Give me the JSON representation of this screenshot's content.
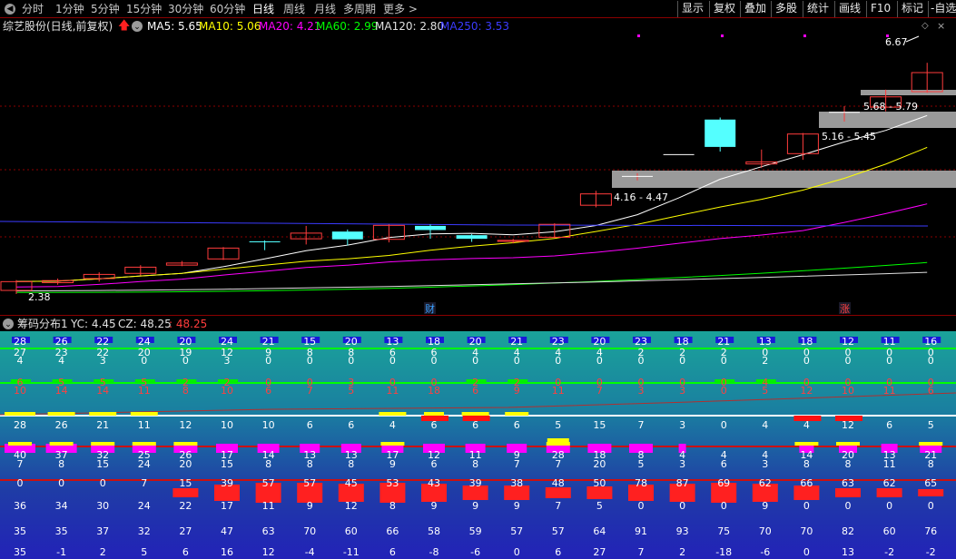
{
  "toolbar": {
    "periods": [
      "分时",
      "1分钟",
      "5分钟",
      "15分钟",
      "30分钟",
      "60分钟",
      "日线",
      "周线",
      "月线",
      "多周期",
      "更多 >"
    ],
    "active_period": "日线",
    "tools": [
      "显示",
      "复权",
      "叠加",
      "多股",
      "统计",
      "画线",
      "F10",
      "标记",
      "-自选"
    ]
  },
  "kline": {
    "title": "综艺股份(日线,前复权)",
    "up_arrow_icon": "red-up-arrow-icon",
    "ma": [
      {
        "label": "MA5: 5.65",
        "color": "#ffffff"
      },
      {
        "label": "MA10: 5.06",
        "color": "#ffff00"
      },
      {
        "label": "MA20: 4.21",
        "color": "#ff00ff"
      },
      {
        "label": "MA60: 2.99",
        "color": "#00ff00"
      },
      {
        "label": "MA120: 2.80",
        "color": "#e0e0e0"
      },
      {
        "label": "MA250: 3.53",
        "color": "#3b3bff"
      }
    ],
    "price_tags": [
      "6.67",
      "5.68 - 5.79",
      "5.16 - 5.45",
      "4.16 - 4.47",
      "2.38"
    ],
    "event_tags": [
      {
        "text": "财",
        "color": "#3aa0ff"
      },
      {
        "text": "涨",
        "color": "#ff4040"
      }
    ],
    "colors": {
      "up": "#ff3c3c",
      "down": "#54ffff",
      "box": "#9a9a9a"
    }
  },
  "chip": {
    "title": "筹码分布1",
    "yc": "YC: 4.45",
    "cz": "CZ: 48.25",
    "cz_delta": ": 48.25"
  },
  "chip_rows": [
    {
      "cells": [
        "28",
        "26",
        "22",
        "24",
        "20",
        "24",
        "21",
        "15",
        "20",
        "13",
        "18",
        "20",
        "21",
        "23",
        "20",
        "23",
        "18",
        "21",
        "13",
        "18",
        "12",
        "11",
        "16"
      ]
    },
    {
      "cells": [
        "27",
        "23",
        "22",
        "20",
        "19",
        "12",
        "9",
        "8",
        "8",
        "6",
        "6",
        "4",
        "4",
        "4",
        "4",
        "2",
        "2",
        "2",
        "0",
        "0",
        "0",
        "0",
        "0"
      ]
    },
    {
      "cells": [
        "4",
        "4",
        "3",
        "0",
        "0",
        "3",
        "0",
        "0",
        "0",
        "0",
        "0",
        "0",
        "0",
        "0",
        "0",
        "0",
        "0",
        "0",
        "2",
        "0",
        "0",
        "0",
        "0"
      ]
    },
    {
      "cells": [
        "6",
        "5",
        "5",
        "5",
        "2",
        "2",
        "0",
        "0",
        "3",
        "0",
        "0",
        "2",
        "2",
        "0",
        "0",
        "0",
        "0",
        "0",
        "4",
        "0",
        "0",
        "0",
        "0"
      ]
    },
    {
      "cells": [
        "10",
        "14",
        "14",
        "11",
        "8",
        "10",
        "6",
        "7",
        "5",
        "11",
        "18",
        "6",
        "9",
        "11",
        "7",
        "3",
        "3",
        "0",
        "5",
        "12",
        "10",
        "11",
        "6"
      ]
    },
    {
      "cells": [
        "28",
        "26",
        "21",
        "11",
        "12",
        "10",
        "10",
        "6",
        "6",
        "4",
        "6",
        "6",
        "6",
        "5",
        "15",
        "7",
        "3",
        "0",
        "4",
        "4",
        "12",
        "6",
        "5"
      ]
    },
    {
      "cells": [
        "40",
        "37",
        "32",
        "25",
        "26",
        "17",
        "14",
        "13",
        "13",
        "17",
        "12",
        "11",
        "9",
        "28",
        "18",
        "8",
        "4",
        "4",
        "4",
        "14",
        "20",
        "13",
        "21"
      ]
    },
    {
      "cells": [
        "7",
        "8",
        "15",
        "24",
        "20",
        "15",
        "8",
        "8",
        "8",
        "9",
        "6",
        "8",
        "7",
        "7",
        "20",
        "5",
        "3",
        "6",
        "3",
        "8",
        "8",
        "11",
        "8"
      ]
    },
    {
      "cells": [
        "0",
        "0",
        "0",
        "7",
        "15",
        "39",
        "57",
        "57",
        "45",
        "53",
        "43",
        "39",
        "38",
        "48",
        "50",
        "78",
        "87",
        "69",
        "62",
        "66",
        "63",
        "62",
        "65"
      ]
    },
    {
      "cells": [
        "36",
        "34",
        "30",
        "24",
        "22",
        "17",
        "11",
        "9",
        "12",
        "8",
        "9",
        "9",
        "9",
        "7",
        "5",
        "0",
        "0",
        "0",
        "9",
        "0",
        "0",
        "0",
        "0"
      ]
    },
    {
      "cells": [
        "35",
        "35",
        "37",
        "32",
        "27",
        "47",
        "63",
        "70",
        "60",
        "66",
        "58",
        "59",
        "57",
        "57",
        "64",
        "91",
        "93",
        "75",
        "70",
        "70",
        "82",
        "60",
        "76"
      ]
    },
    {
      "cells": [
        "35",
        "-1",
        "2",
        "5",
        "6",
        "16",
        "12",
        "-4",
        "-11",
        "6",
        "-8",
        "-6",
        "0",
        "6",
        "27",
        "7",
        "2",
        "-18",
        "-6",
        "0",
        "13",
        "-2",
        "-2"
      ]
    }
  ],
  "chart_data": {
    "type": "candlestick",
    "series": [
      {
        "values": [
          {
            "o": 2.45,
            "c": 2.62,
            "h": 2.65,
            "l": 2.38
          },
          {
            "o": 2.6,
            "c": 2.64,
            "h": 2.68,
            "l": 2.56
          },
          {
            "o": 2.68,
            "c": 2.76,
            "h": 2.8,
            "l": 2.62
          },
          {
            "o": 2.78,
            "c": 2.9,
            "h": 2.94,
            "l": 2.74
          },
          {
            "o": 2.94,
            "c": 2.98,
            "h": 3.02,
            "l": 2.92
          },
          {
            "o": 3.06,
            "c": 3.27,
            "h": 3.29,
            "l": 3.04
          },
          {
            "o": 3.4,
            "c": 3.39,
            "h": 3.42,
            "l": 3.23
          },
          {
            "o": 3.45,
            "c": 3.56,
            "h": 3.7,
            "l": 3.34
          },
          {
            "o": 3.59,
            "c": 3.44,
            "h": 3.63,
            "l": 3.32
          },
          {
            "o": 3.44,
            "c": 3.71,
            "h": 3.73,
            "l": 3.38
          },
          {
            "o": 3.7,
            "c": 3.62,
            "h": 3.73,
            "l": 3.45
          },
          {
            "o": 3.52,
            "c": 3.45,
            "h": 3.54,
            "l": 3.39
          },
          {
            "o": 3.4,
            "c": 3.42,
            "h": 3.45,
            "l": 3.36
          },
          {
            "o": 3.48,
            "c": 3.73,
            "h": 3.75,
            "l": 3.46
          },
          {
            "o": 4.1,
            "c": 4.32,
            "h": 4.38,
            "l": 4.06
          },
          {
            "o": 4.66,
            "c": 4.66,
            "h": 4.72,
            "l": 4.58
          },
          {
            "o": 5.08,
            "c": 5.08,
            "h": 5.08,
            "l": 5.08
          },
          {
            "o": 5.76,
            "c": 5.23,
            "h": 5.8,
            "l": 5.14
          },
          {
            "o": 4.9,
            "c": 4.94,
            "h": 5.18,
            "l": 4.82
          },
          {
            "o": 5.1,
            "c": 5.48,
            "h": 5.5,
            "l": 4.98
          },
          {
            "o": 5.9,
            "c": 5.9,
            "h": 6.02,
            "l": 5.72
          },
          {
            "o": 6.0,
            "c": 6.2,
            "h": 6.34,
            "l": 5.92
          },
          {
            "o": 6.3,
            "c": 6.67,
            "h": 6.86,
            "l": 6.28
          }
        ]
      }
    ],
    "grid": true
  }
}
